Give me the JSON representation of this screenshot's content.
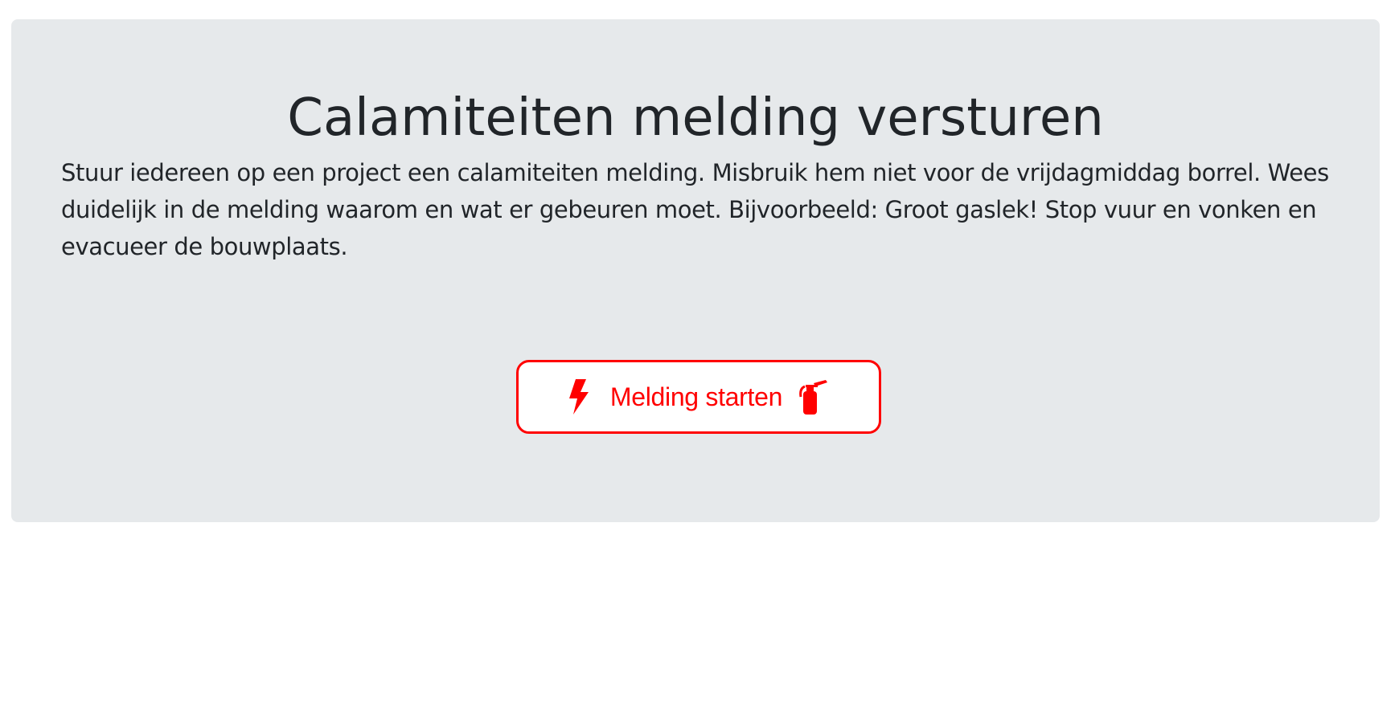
{
  "jumbotron": {
    "title": "Calamiteiten melding versturen",
    "description": "Stuur iedereen op een project een calamiteiten melding. Misbruik hem niet voor de vrijdagmiddag borrel. Wees duidelijk in de melding waarom en wat er gebeuren moet. Bijvoorbeeld: Groot gaslek! Stop vuur en vonken en evacueer de bouwplaats."
  },
  "start_button": {
    "label": "Melding starten",
    "left_icon": "bolt-icon",
    "right_icon": "fire-extinguisher-icon"
  },
  "colors": {
    "accent": "#ff0000",
    "panel_background": "#e6e9eb",
    "text": "#212529"
  }
}
